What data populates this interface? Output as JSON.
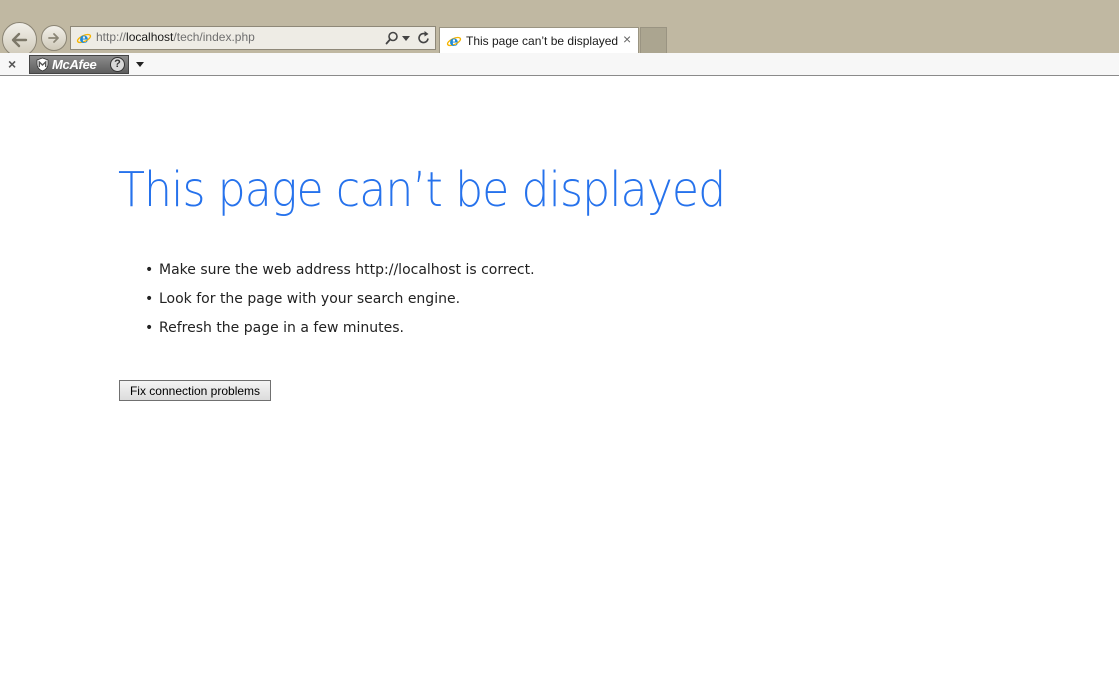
{
  "browser": {
    "address_bar": {
      "url_prefix": "http://",
      "url_host": "localhost",
      "url_path": "/tech/index.php"
    },
    "tabs": [
      {
        "title": "This page can’t be displayed",
        "close_glyph": "×"
      }
    ],
    "toolbar": {
      "close_glyph": "×",
      "mcafee_label": "McAfee",
      "mcafee_help": "?"
    }
  },
  "page": {
    "title": "This page can’t be displayed",
    "tips": [
      "Make sure the web address http://localhost is correct.",
      "Look for the page with your search engine.",
      "Refresh the page in a few minutes."
    ],
    "bullet": "•",
    "fix_button_label": "Fix connection problems"
  },
  "icons": {
    "back": "arrow-left-icon",
    "forward": "arrow-right-icon",
    "ie": "ie-logo-icon",
    "search": "search-icon",
    "dropdown": "chevron-down-icon",
    "refresh": "refresh-icon",
    "mcafee": "mcafee-shield-icon"
  },
  "colors": {
    "title": "#2672ec",
    "chrome": "#c0b8a2"
  }
}
